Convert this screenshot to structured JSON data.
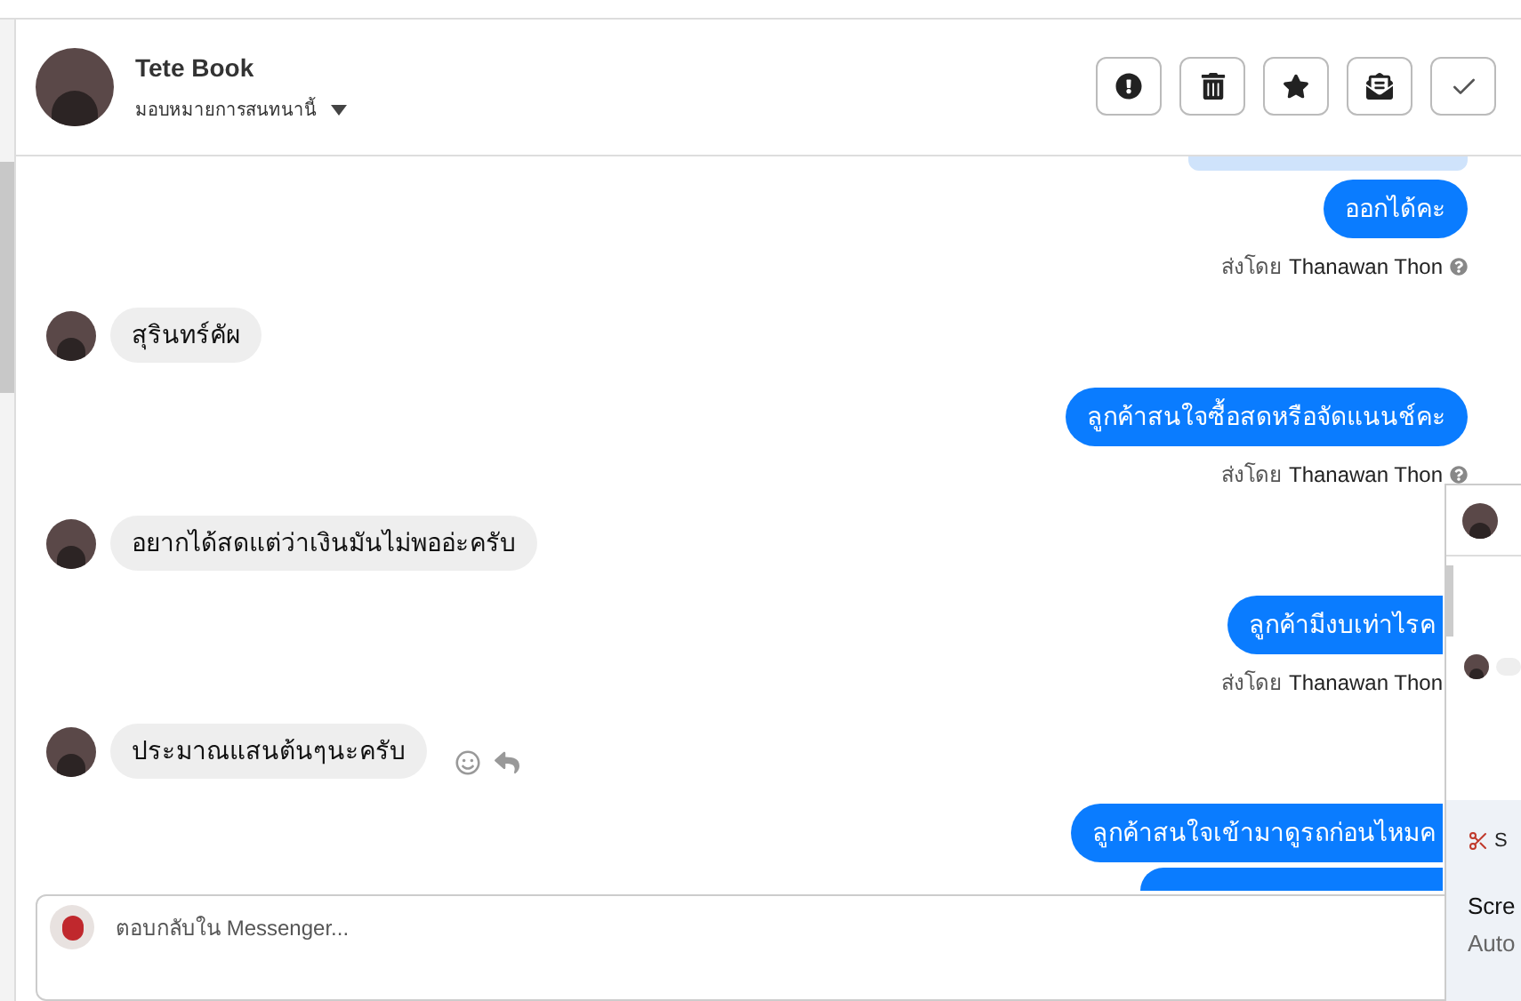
{
  "header": {
    "name": "Tete Book",
    "assign_label": "มอบหมายการสนทนานี้"
  },
  "toolbar": [
    {
      "kind": "spam"
    },
    {
      "kind": "delete"
    },
    {
      "kind": "star"
    },
    {
      "kind": "unread"
    },
    {
      "kind": "done"
    }
  ],
  "messages": [
    {
      "kind": "quote"
    },
    {
      "kind": "out",
      "text": "ออกได้คะ",
      "sender_prefix": "ส่งโดย",
      "sender": "Thanawan Thon",
      "help": true,
      "clipped": false
    },
    {
      "kind": "in",
      "text": "สุรินทร์คัผ",
      "actions": false
    },
    {
      "kind": "out",
      "text": "ลูกค้าสนใจซื้อสดหรือจัดแนนช์คะ",
      "sender_prefix": "ส่งโดย",
      "sender": "Thanawan Thon",
      "help": true,
      "clipped": false
    },
    {
      "kind": "in",
      "text": "อยากได้สดแต่ว่าเงินมันไม่พออ่ะครับ",
      "actions": false
    },
    {
      "kind": "out",
      "text": "ลูกค้ามีงบเท่าไรค",
      "sender_prefix": "ส่งโดย",
      "sender": "Thanawan Thon",
      "help": false,
      "clipped": true
    },
    {
      "kind": "in",
      "text": "ประมาณแสนต้นๆนะครับ",
      "actions": true
    },
    {
      "kind": "out",
      "text": "ลูกค้าสนใจเข้ามาดูรถก่อนไหมค",
      "clipped": true
    },
    {
      "kind": "partial"
    }
  ],
  "composer": {
    "placeholder": "ตอบกลับใน Messenger..."
  },
  "notification": {
    "app": "S",
    "title": "Scre",
    "subtitle": "Auto"
  }
}
